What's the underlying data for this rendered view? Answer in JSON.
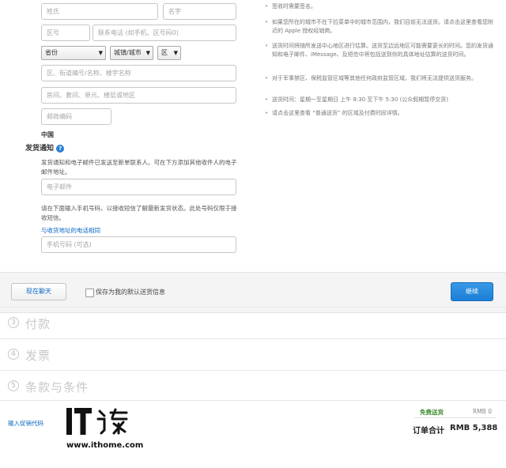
{
  "form": {
    "last_name_placeholder": "姓氏",
    "first_name_placeholder": "名字",
    "area_code_placeholder": "区号",
    "phone_placeholder": "联系电话 (如手机、区号码0)",
    "province_select": "省份",
    "city_select": "城镇/城市",
    "district_select": "区",
    "street_placeholder": "区、街道编号/名称、楼宇名称",
    "room_placeholder": "房间、套间、单元、楼层或地区",
    "postcode_placeholder": "邮政编码",
    "country": "中国",
    "notify_heading": "发货通知",
    "notify_desc": "发货通知和电子邮件已发送至新单联系人。可在下方添加其他收件人的电子邮件地址。",
    "email_placeholder": "电子邮件",
    "mobile_desc": "请在下面输入手机号码，以接收短信了解最新发货状态。此处号码仅限于接收短信。",
    "same_phone_link": "与收货地址的电话相同",
    "mobile_placeholder": "手机号码 (可选)"
  },
  "notes": [
    "签收时需要签名。",
    "如果您所在的城市不在下拉菜单中的城市范围内，我们目前无法送货。请点击这里查看您附近的 Apple 授权经销商。",
    "送货时间将随所发送中心地区进行估算。送货至边远地区可能需要更长的时间。您的发货通知和电子邮件、iMessage、及短信中将包括送到你的具体地址估算的送货时间。",
    "对于军事禁区、保税监管区域等其他任何政府监管区域，我们将无法提供送货服务。",
    "送货时间：星期一至星期日 上午 8:30 至下午 5:30 (公众假期暂停交货)",
    "请点击这里查看 “普通送货” 的区域及付费时段详情。"
  ],
  "toolbar": {
    "chat_button": "现在聊天",
    "save_default_label": "保存为我的默认送货信息",
    "continue_button": "继续"
  },
  "steps": [
    {
      "number": "3",
      "title": "付款"
    },
    {
      "number": "4",
      "title": "发票"
    },
    {
      "number": "5",
      "title": "条款与条件"
    }
  ],
  "summary": {
    "promo_link": "输入促销代码",
    "shipping_label": "免费送货",
    "shipping_value": "RMB 0",
    "total_label": "订单合计",
    "total_value": "RMB 5,388"
  },
  "watermark": {
    "logo_text": "IT之家",
    "url": "www.ithome.com"
  },
  "colors": {
    "accent": "#0a66c2",
    "continue_button": "#1a7fd6",
    "free_shipping": "#3c8b2e"
  }
}
